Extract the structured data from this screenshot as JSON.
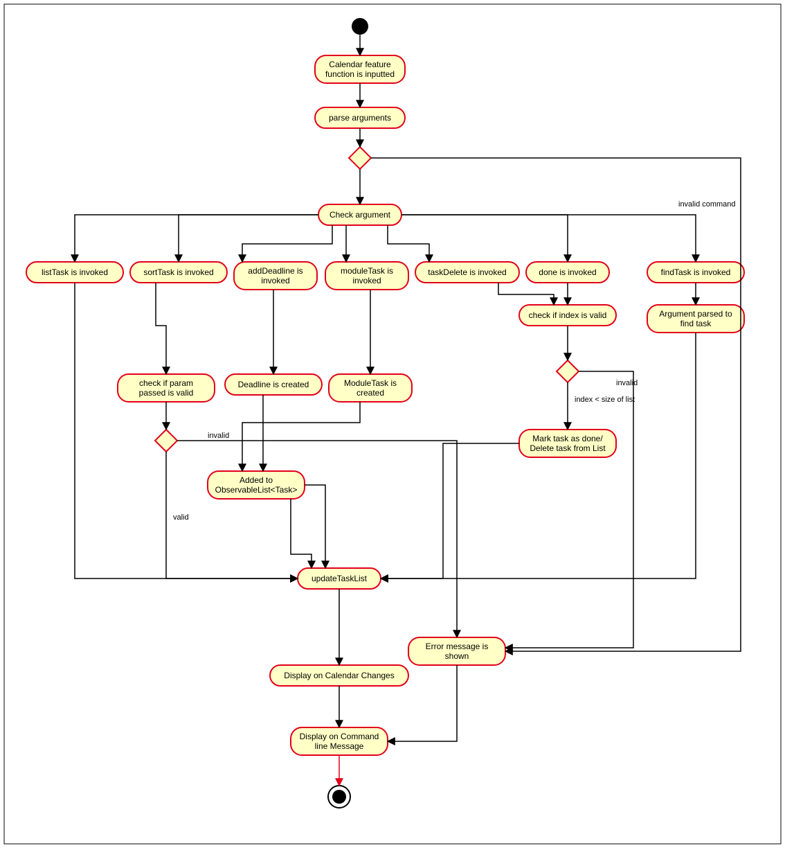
{
  "nodes": {
    "start": {
      "label": ""
    },
    "calendar_feature": {
      "label": "Calendar feature function is inputted"
    },
    "parse_args": {
      "label": "parse arguments"
    },
    "check_arg": {
      "label": "Check argument"
    },
    "listTask": {
      "label": "listTask is invoked"
    },
    "sortTask": {
      "label": "sortTask is invoked"
    },
    "addDeadline": {
      "label": "addDeadline is invoked"
    },
    "moduleTask": {
      "label": "moduleTask is invoked"
    },
    "taskDelete": {
      "label": "taskDelete is invoked"
    },
    "done": {
      "label": "done is invoked"
    },
    "findTask": {
      "label": "findTask is invoked"
    },
    "check_param": {
      "label": "check if param passed is valid"
    },
    "deadline_created": {
      "label": "Deadline is created"
    },
    "moduleTask_created": {
      "label": "ModuleTask is created"
    },
    "check_index": {
      "label": "check if index is valid"
    },
    "arg_parsed_find": {
      "label": "Argument parsed to find task"
    },
    "mark_delete": {
      "label": "Mark task as done/ Delete task from List"
    },
    "added_obs": {
      "label": "Added to ObservableList<Task>"
    },
    "updateTaskList": {
      "label": "updateTaskList"
    },
    "error_msg": {
      "label": "Error message is shown"
    },
    "display_cal": {
      "label": "Display on Calendar Changes"
    },
    "display_cmd": {
      "label": "Display on Command line Message"
    },
    "end": {
      "label": ""
    }
  },
  "edge_labels": {
    "invalid_command": "invalid command",
    "invalid": "invalid",
    "valid": "valid",
    "index_lt_size": "index < size of list"
  }
}
